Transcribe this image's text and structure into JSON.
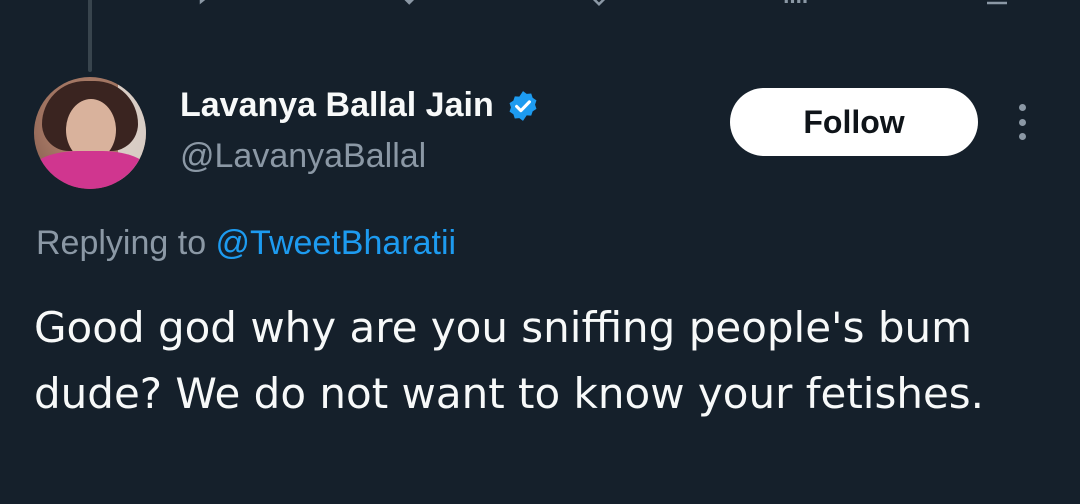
{
  "prev_tweet": {
    "actions": [
      {
        "icon": "reply-icon"
      },
      {
        "icon": "retweet-icon"
      },
      {
        "icon": "like-icon"
      },
      {
        "icon": "views-icon"
      },
      {
        "icon": "bookmark-icon"
      }
    ]
  },
  "tweet": {
    "author": {
      "display_name": "Lavanya Ballal Jain",
      "handle": "@LavanyaBallal",
      "verified_icon": "verified-badge-icon",
      "verified_color": "#1d9bf0"
    },
    "follow_label": "Follow",
    "more_icon": "more-vertical-icon",
    "replying_prefix": "Replying to ",
    "replying_to": "@TweetBharatii",
    "text": "Good god why are you sniffing people's bum dude? We do not want to know your fetishes."
  },
  "colors": {
    "background": "#15202b",
    "primary_text": "#f7f9f9",
    "secondary_text": "#8b98a5",
    "accent": "#1d9bf0"
  }
}
